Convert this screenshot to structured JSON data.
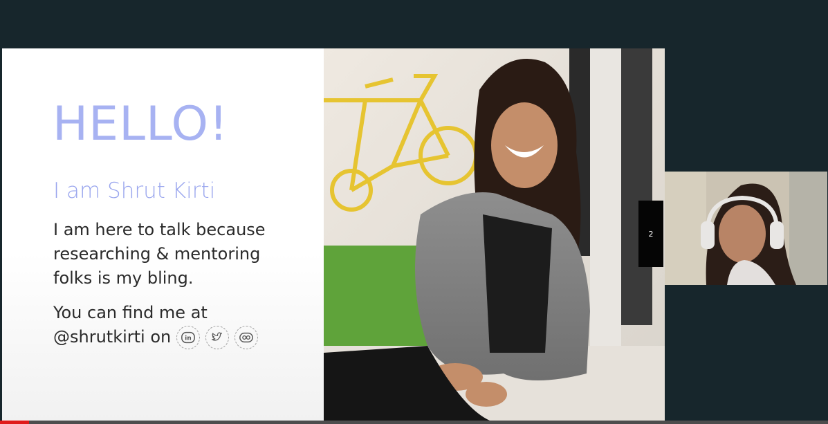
{
  "slide": {
    "heading": "HELLO!",
    "name_line": "I am Shrut Kirti",
    "bio": "I am here to talk because researching & mentoring folks is my bling.",
    "find_line": "You can find me at",
    "handle": "@shrutkirti on",
    "social_icons": [
      "linkedin-icon",
      "twitter-icon",
      "flickr-icon"
    ],
    "page_number": "2"
  },
  "colors": {
    "heading": "#a7b2f2",
    "name": "#9aa6ee",
    "background": "#17262c",
    "progress": "#e01b1b"
  },
  "video": {
    "progress_fraction": 0.035
  }
}
